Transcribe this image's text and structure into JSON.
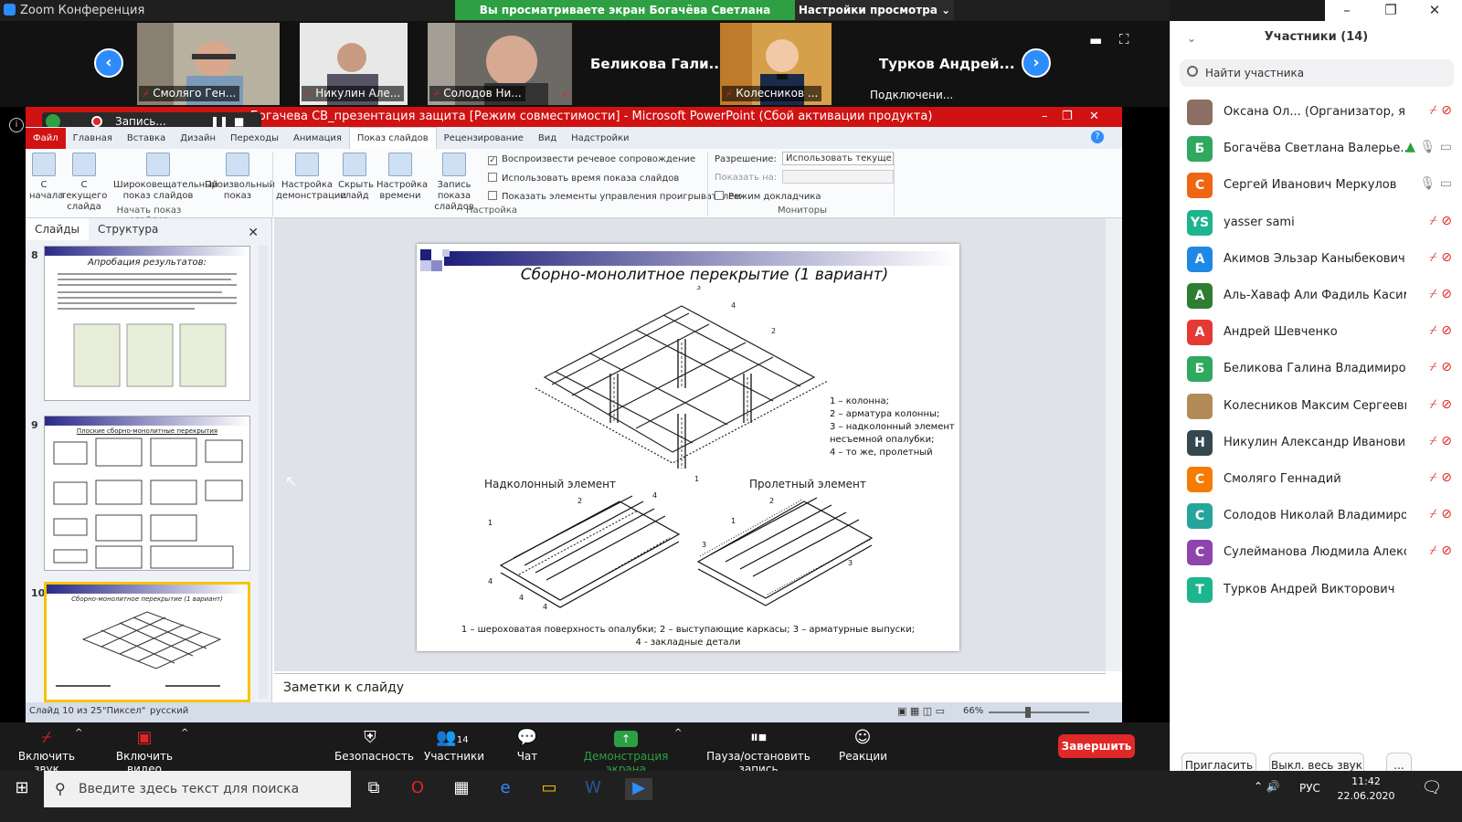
{
  "window": {
    "title": "Zoom Конференция",
    "controls": [
      "–",
      "❐",
      "✕"
    ]
  },
  "banner": {
    "viewing": "Вы просматриваете экран Богачёва Светлана Валерьевна",
    "view_options": "Настройки просмотра ⌄"
  },
  "video_tiles": [
    {
      "name": "Смоляго Ген...",
      "type": "video"
    },
    {
      "name": "Никулин Але...",
      "type": "video"
    },
    {
      "name": "Солодов Ни...",
      "type": "video"
    },
    {
      "name": "Беликова Гали...",
      "type": "name"
    },
    {
      "name": "Колесников ...",
      "type": "video"
    },
    {
      "name": "Турков Андрей...",
      "type": "name",
      "status": "Подключени..."
    }
  ],
  "participants": {
    "header": "Участники (14)",
    "search_placeholder": "Найти участника",
    "list": [
      {
        "initial": "",
        "name": "Оксана Ол... (Организатор, я)",
        "color": "#8d6e63",
        "photo": true
      },
      {
        "initial": "Б",
        "name": "Богачёва Светлана Валерье...",
        "color": "#2fa860"
      },
      {
        "initial": "С",
        "name": "Сергей Иванович Меркулов",
        "color": "#ee6611"
      },
      {
        "initial": "YS",
        "name": "yasser sami",
        "color": "#1cb58e"
      },
      {
        "initial": "А",
        "name": "Акимов Эльзар Каныбекович",
        "color": "#1e88e5"
      },
      {
        "initial": "А",
        "name": "Аль-Хаваф Али Фадиль Касим",
        "color": "#2e7d32"
      },
      {
        "initial": "А",
        "name": "Андрей Шевченко",
        "color": "#e53935"
      },
      {
        "initial": "Б",
        "name": "Беликова Галина Владимировна",
        "color": "#2fa860"
      },
      {
        "initial": "",
        "name": "Колесников Максим Сергеевич ...",
        "color": "#b38b59",
        "photo": true
      },
      {
        "initial": "Н",
        "name": "Никулин Александр Иванович",
        "color": "#37474f"
      },
      {
        "initial": "С",
        "name": "Смоляго Геннадий",
        "color": "#f57c00"
      },
      {
        "initial": "С",
        "name": "Солодов Николай Владимирович",
        "color": "#26a69a"
      },
      {
        "initial": "С",
        "name": "Сулейманова Людмила Алексан...",
        "color": "#8e44ad"
      },
      {
        "initial": "Т",
        "name": "Турков Андрей Викторович",
        "color": "#1cb58e"
      }
    ],
    "invite": "Пригласить",
    "mute_all": "Выкл. весь звук",
    "more": "..."
  },
  "powerpoint": {
    "title": "Богачева СВ_презентация защита [Режим совместимости] - Microsoft PowerPoint (Сбой активации продукта)",
    "recording": "Запись...",
    "tabs": [
      "Файл",
      "Главная",
      "Вставка",
      "Дизайн",
      "Переходы",
      "Анимация",
      "Показ слайдов",
      "Рецензирование",
      "Вид",
      "Надстройки"
    ],
    "ribbon_buttons": [
      "С начала",
      "С текущего слайда",
      "Широковещательный показ слайдов",
      "Произвольный показ"
    ],
    "ribbon_buttons2": [
      "Настройка демонстрации",
      "Скрыть слайд",
      "Настройка времени",
      "Запись показа слайдов"
    ],
    "group1": "Начать показ слайдов",
    "group2": "Настройка",
    "group3": "Мониторы",
    "checkboxes": [
      "Воспроизвести речевое сопровождение",
      "Использовать время показа слайдов",
      "Показать элементы управления проигрывателем"
    ],
    "resolution_label": "Разрешение:",
    "resolution_value": "Использовать текуще...",
    "show_on": "Показать на:",
    "presenter": "Режим докладчика",
    "pane_tabs": [
      "Слайды",
      "Структура"
    ],
    "thumbs": [
      {
        "num": "8",
        "title": "Апробация результатов:"
      },
      {
        "num": "9",
        "title": "Плоские сборно-монолитные перекрытия"
      },
      {
        "num": "10",
        "title": "Сборно-монолитное перекрытие (1 вариант)"
      }
    ],
    "notes": "Заметки к слайду",
    "status": [
      "Слайд 10 из 25",
      "\"Пиксел\"",
      "русский"
    ],
    "zoom": "66%"
  },
  "slide": {
    "title": "Сборно-монолитное перекрытие (1 вариант)",
    "legend": [
      "1 – колонна;",
      "2 – арматура колонны;",
      "3 – надколонный элемент",
      "несъемной опалубки;",
      "4 – то же, пролетный"
    ],
    "label_left": "Надколонный  элемент",
    "label_right": "Пролетный  элемент",
    "caption1": "1 – шероховатая поверхность опалубки; 2 – выступающие каркасы; 3 – арматурные выпуски;",
    "caption2": "4 - закладные детали"
  },
  "toolbar": {
    "unmute": "Включить звук",
    "start_video": "Включить видео",
    "security": "Безопасность",
    "participants": "Участники",
    "participants_count": "14",
    "chat": "Чат",
    "share": "Демонстрация экрана",
    "record": "Пауза/остановить запись",
    "reactions": "Реакции",
    "end": "Завершить"
  },
  "taskbar": {
    "search": "Введите здесь текст для поиска",
    "lang": "РУС",
    "time": "11:42",
    "date": "22.06.2020"
  },
  "colors": {
    "zoom_blue": "#2d8cff",
    "banner_green": "#2ea043",
    "ppt_red": "#d11212",
    "end_red": "#e02828"
  }
}
